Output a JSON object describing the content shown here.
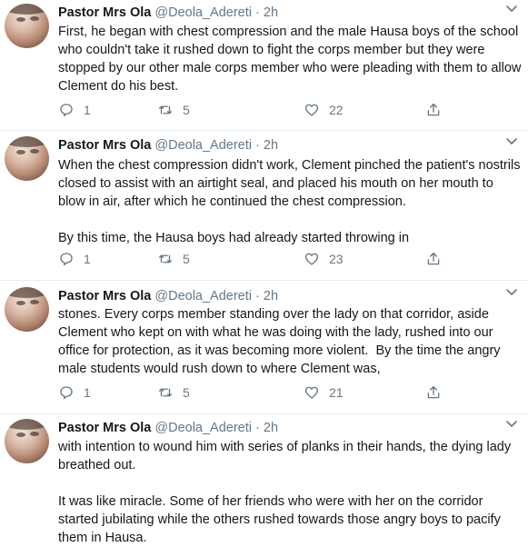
{
  "tweets": [
    {
      "name": "Pastor Mrs Ola",
      "handle": "@Deola_Adereti",
      "sep": "·",
      "time": "2h",
      "text": "First, he began with chest compression and the male Hausa boys of the school who couldn't take it rushed down to fight the corps member but they were stopped by our other male corps member who were pleading with them to allow Clement do his best.",
      "replies": "1",
      "retweets": "5",
      "likes": "22"
    },
    {
      "name": "Pastor Mrs Ola",
      "handle": "@Deola_Adereti",
      "sep": "·",
      "time": "2h",
      "text": "When the chest compression didn't work, Clement pinched the patient's nostrils closed to assist with an airtight seal, and placed his mouth on her mouth to blow in air, after which he continued the chest compression.\n\nBy this time, the Hausa boys had already started throwing in",
      "replies": "1",
      "retweets": "5",
      "likes": "23"
    },
    {
      "name": "Pastor Mrs Ola",
      "handle": "@Deola_Adereti",
      "sep": "·",
      "time": "2h",
      "text": "stones. Every corps member standing over the lady on that corridor, aside Clement who kept on with what he was doing with the lady, rushed into our office for protection, as it was becoming more violent.  By the time the angry male students would rush down to where Clement was,",
      "replies": "1",
      "retweets": "5",
      "likes": "21"
    },
    {
      "name": "Pastor Mrs Ola",
      "handle": "@Deola_Adereti",
      "sep": "·",
      "time": "2h",
      "text": "with intention to wound him with series of planks in their hands, the dying lady breathed out.\n\nIt was like miracle. Some of her friends who were with her on the corridor started jubilating while the others rushed towards those angry boys to pacify them in Hausa.",
      "replies": "",
      "retweets": "",
      "likes": ""
    }
  ],
  "icons": {
    "avatar": "profile-photo",
    "more": "chevron-down-icon",
    "reply": "reply-icon",
    "retweet": "retweet-icon",
    "like": "heart-icon",
    "share": "share-icon"
  },
  "colors": {
    "text": "#14171a",
    "secondary": "#657786",
    "divider": "#e6ecf0"
  }
}
